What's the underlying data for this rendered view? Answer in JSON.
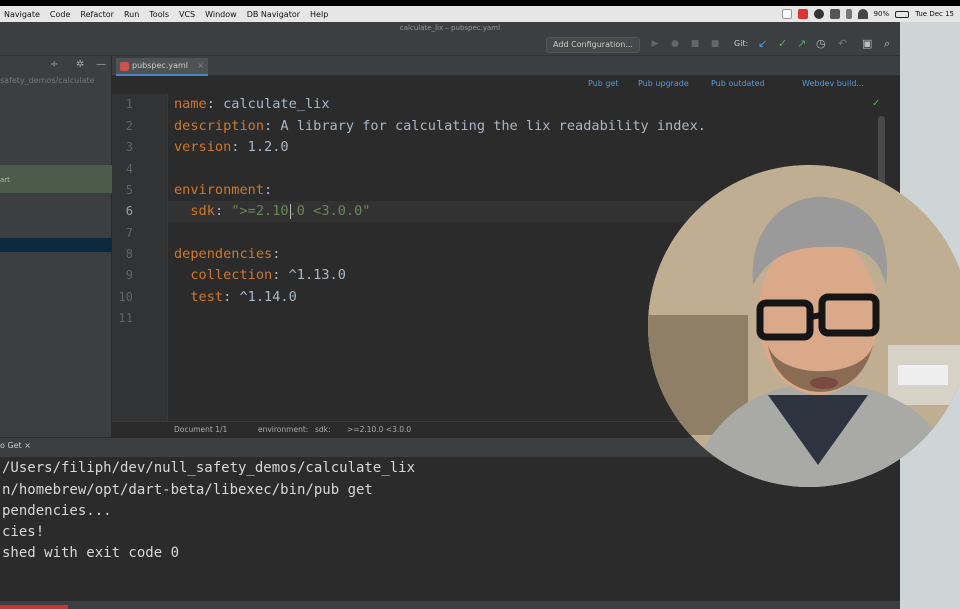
{
  "menu_bar": {
    "items": [
      "Navigate",
      "Code",
      "Refactor",
      "Run",
      "Tools",
      "VCS",
      "Window",
      "DB Navigator",
      "Help"
    ],
    "battery": "90%",
    "clock": "Tue Dec 15"
  },
  "window": {
    "title": "calculate_lix – pubspec.yaml"
  },
  "toolbar": {
    "add_configuration": "Add Configuration...",
    "git_label": "Git:"
  },
  "project_panel": {
    "path": "safety_demos/calculate",
    "dart_row": "art"
  },
  "editor_tab": {
    "label": "pubspec.yaml",
    "close": "×"
  },
  "pub_actions": {
    "pub_get": "Pub get",
    "pub_upgrade": "Pub upgrade",
    "pub_outdated": "Pub outdated",
    "webdev_build": "Webdev build..."
  },
  "editor": {
    "line_numbers": [
      "1",
      "2",
      "3",
      "4",
      "5",
      "6",
      "7",
      "8",
      "9",
      "10",
      "11"
    ],
    "code": {
      "l1_key": "name",
      "l1_val": " calculate_lix",
      "l2_key": "description",
      "l2_val": " A library for calculating the lix readability index.",
      "l3_key": "version",
      "l3_val": " 1.2.0",
      "l5_key": "environment",
      "l6_key": "sdk",
      "l6_val": "\">=2.10.0 <3.0.0\"",
      "l8_key": "dependencies",
      "l9_key": "collection",
      "l9_val": " ^1.13.0",
      "l10_key": "test",
      "l10_val": " ^1.14.0"
    }
  },
  "breadcrumb": {
    "doc": "Document 1/1",
    "env": "environment:",
    "sdk": "sdk:",
    "value": ">=2.10.0 <3.0.0"
  },
  "run_window": {
    "tab": "o Get",
    "lines": [
      "/Users/filiph/dev/null_safety_demos/calculate_lix",
      "n/homebrew/opt/dart-beta/libexec/bin/pub get",
      "pendencies...",
      "cies!",
      "shed with exit code 0"
    ]
  },
  "colors": {
    "accent": "#4a88c7",
    "keyword": "#cc7832",
    "string": "#6a8759",
    "link": "#5a9bd5"
  }
}
